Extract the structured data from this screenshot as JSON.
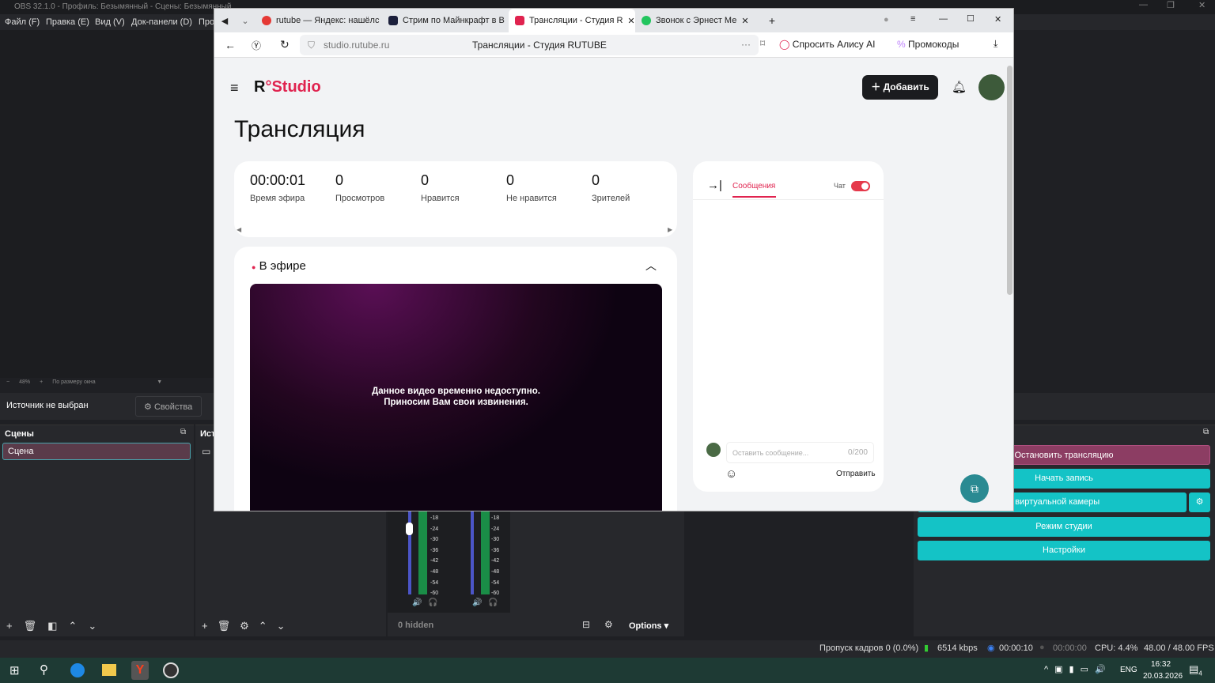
{
  "obs": {
    "title": "OBS 32.1.0 - Профиль: Безымянный - Сцены: Безымянный",
    "menu": [
      "Файл (F)",
      "Правка (E)",
      "Вид (V)",
      "Док-панели (D)",
      "Про"
    ],
    "zoom": {
      "minus": "−",
      "value": "48%",
      "plus": "+",
      "fit": "По размеру окна"
    },
    "source_status": "Источник не выбран",
    "properties_label": "Свойства",
    "scenes_title": "Сцены",
    "scenes": [
      "Сцена"
    ],
    "sources_title": "Ист",
    "mixer_ticks": [
      "-18",
      "-24",
      "-30",
      "-36",
      "-42",
      "-48",
      "-54",
      "-60"
    ],
    "hidden_label": "0 hidden",
    "options_label": "Options",
    "controls": {
      "stop_stream": "Остановить трансляцию",
      "start_record": "Начать запись",
      "virtual_cam": "ск виртуальной камеры",
      "studio_mode": "Режим студии",
      "settings": "Настройки"
    },
    "status": {
      "dropped": "Пропуск кадров 0 (0.0%)",
      "bitrate": "6514 kbps",
      "stream_time": "00:00:10",
      "record_time": "00:00:00",
      "cpu": "CPU: 4.4%",
      "fps": "48.00 / 48.00 FPS"
    }
  },
  "browser": {
    "tabs": [
      {
        "label": "rutube — Яндекс: нашёлс",
        "color": "#e53935"
      },
      {
        "label": "Стрим по Майнкрафт в В",
        "color": "#1b1f3b"
      },
      {
        "label": "Трансляции - Студия R",
        "color": "#e0234f",
        "active": true
      },
      {
        "label": "Звонок с Эрнест Ме",
        "color": "#22c55e"
      }
    ],
    "url": "studio.rutube.ru",
    "page_title": "Трансляции - Студия RUTUBE",
    "alice": "Спросить Алису AI",
    "promo": "Промокоды"
  },
  "studio": {
    "logo": "R Studio",
    "add_label": "Добавить",
    "heading": "Трансляция",
    "stats": [
      {
        "value": "00:00:01",
        "label": "Время эфира"
      },
      {
        "value": "0",
        "label": "Просмотров"
      },
      {
        "value": "0",
        "label": "Нравится"
      },
      {
        "value": "0",
        "label": "Не нравится"
      },
      {
        "value": "0",
        "label": "Зрителей"
      }
    ],
    "live_label": "В эфире",
    "video_msg1": "Данное видео временно недоступно.",
    "video_msg2": "Приносим Вам свои извинения.",
    "chat_tab": "Сообщения",
    "chat_toggle": "Чат",
    "chat_placeholder": "Оставить сообщение...",
    "chat_counter": "0/200",
    "send_label": "Отправить"
  },
  "taskbar": {
    "lang": "ENG",
    "time": "16:32",
    "date": "20.03.2026",
    "notif": "4"
  }
}
